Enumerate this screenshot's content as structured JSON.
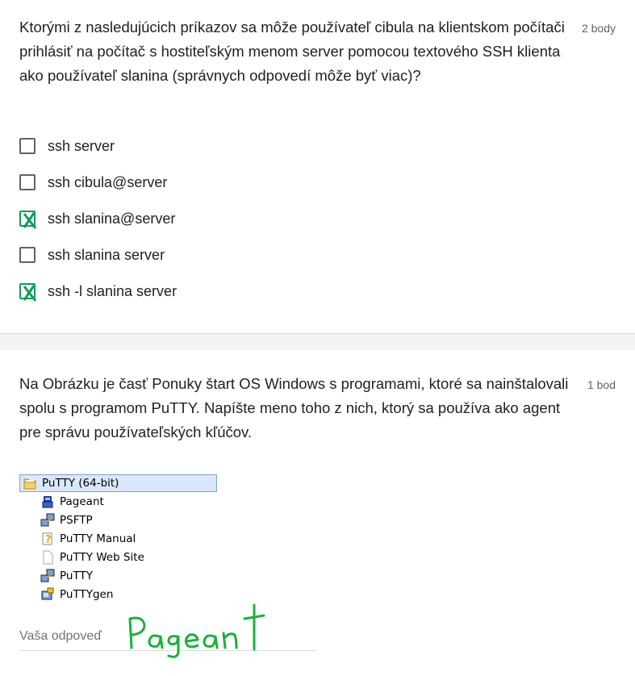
{
  "question1": {
    "text": "Ktorými z nasledujúcich príkazov sa môže používateľ cibula na klientskom počítači prihlásiť na počítač s hostiteľským menom server pomocou textového SSH klienta ako používateľ slanina (správnych odpovedí môže byť viac)?",
    "points": "2 body",
    "options": [
      {
        "label": "ssh server",
        "checked": false
      },
      {
        "label": "ssh cibula@server",
        "checked": false
      },
      {
        "label": "ssh slanina@server",
        "checked": true
      },
      {
        "label": "ssh slanina server",
        "checked": false
      },
      {
        "label": "ssh -l slanina server",
        "checked": true
      }
    ]
  },
  "question2": {
    "text": "Na Obrázku je časť Ponuky štart OS Windows s programami, ktoré sa nainštalovali spolu s programom PuTTY. Napíšte meno toho z nich, ktorý sa používa ako agent pre správu používateľských kľúčov.",
    "points": "1 bod",
    "menu": {
      "root": "PuTTY (64-bit)",
      "items": [
        {
          "label": "Pageant",
          "icon": "pageant-icon"
        },
        {
          "label": "PSFTP",
          "icon": "psftp-icon"
        },
        {
          "label": "PuTTY Manual",
          "icon": "help-file-icon"
        },
        {
          "label": "PuTTY Web Site",
          "icon": "blank-file-icon"
        },
        {
          "label": "PuTTY",
          "icon": "putty-icon"
        },
        {
          "label": "PuTTYgen",
          "icon": "puttygen-icon"
        }
      ]
    },
    "answer_placeholder": "Vaša odpoveď",
    "handwritten_answer": "Pageant"
  },
  "colors": {
    "check": "#0f9d58",
    "handwriting": "#18b23a",
    "text": "#202124",
    "muted": "#5f6368"
  }
}
